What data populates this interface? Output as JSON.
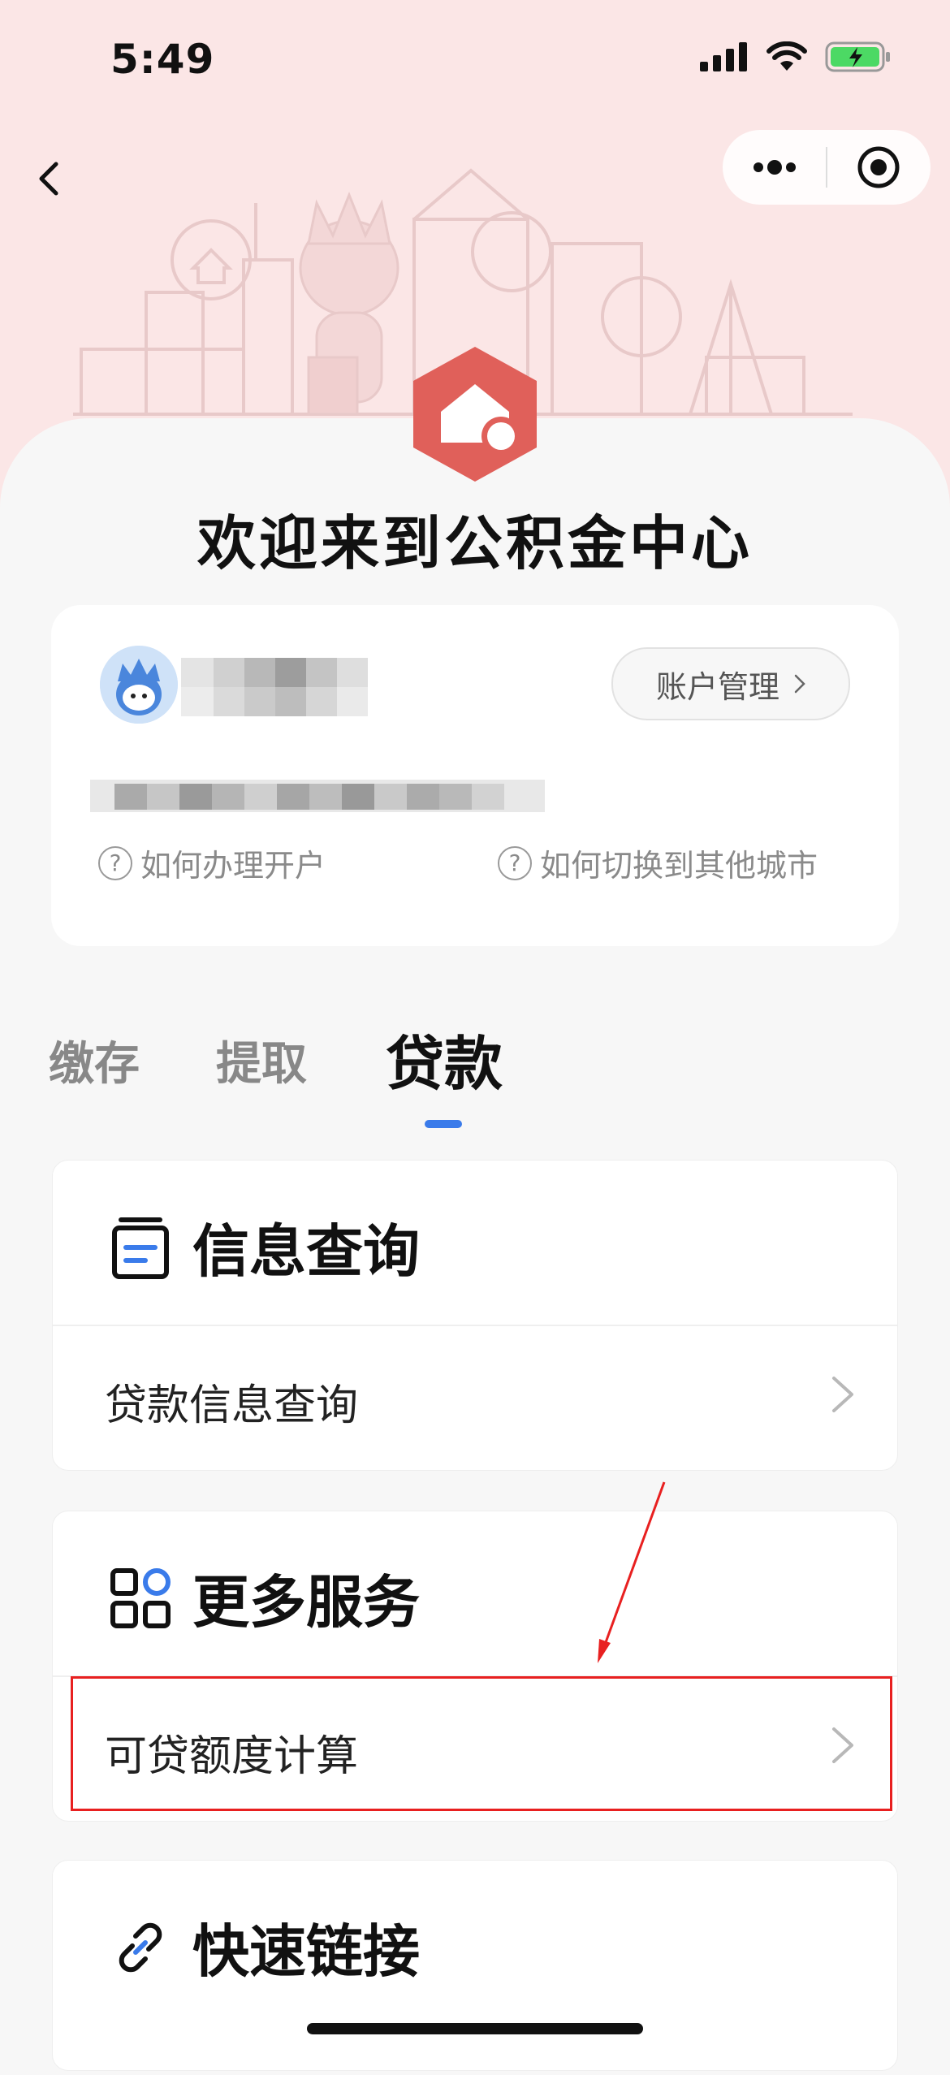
{
  "status_bar": {
    "time": "5:49"
  },
  "nav": {
    "back_icon": "chevron-left-icon",
    "more_icon": "more-dots-icon",
    "close_icon": "target-icon"
  },
  "hero": {
    "welcome": "欢迎来到公积金中心",
    "logo_color": "#e0605a"
  },
  "account": {
    "manage_label": "账户管理",
    "help_open": "如何办理开户",
    "help_switch": "如何切换到其他城市"
  },
  "tabs": [
    {
      "label": "缴存",
      "active": false
    },
    {
      "label": "提取",
      "active": false
    },
    {
      "label": "贷款",
      "active": true
    }
  ],
  "info_section": {
    "title": "信息查询",
    "icon": "document-icon",
    "items": [
      {
        "label": "贷款信息查询"
      }
    ]
  },
  "more_section": {
    "title": "更多服务",
    "icon": "grid-apps-icon",
    "items": [
      {
        "label": "可贷额度计算"
      }
    ]
  },
  "quick_section": {
    "title": "快速链接",
    "icon": "link-icon"
  },
  "colors": {
    "accent_blue": "#3a7bea",
    "highlight_red": "#e82020",
    "hero_bg": "#fbe6e6"
  }
}
